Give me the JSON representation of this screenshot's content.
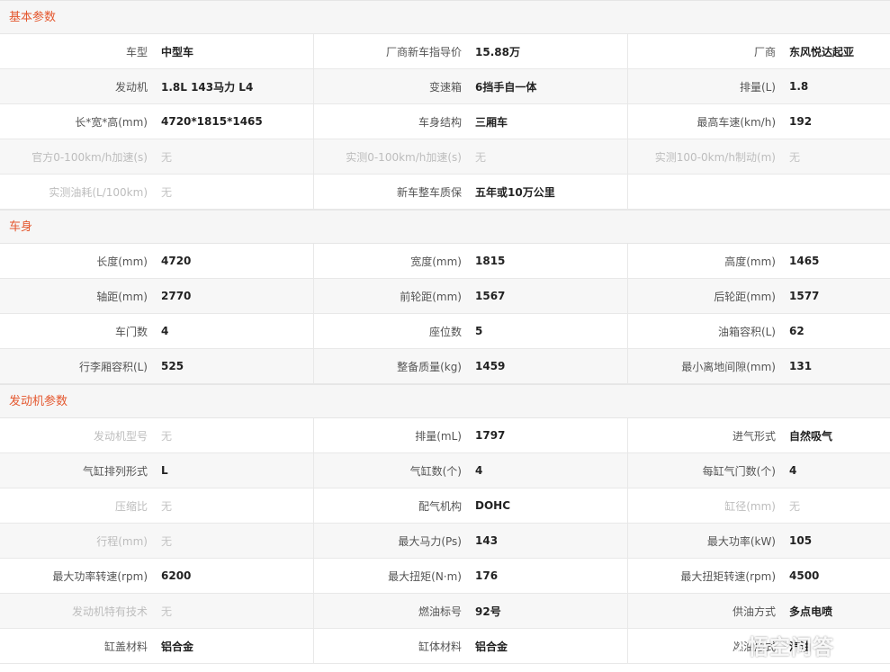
{
  "sections": [
    {
      "title": "基本参数",
      "rows": [
        [
          {
            "label": "车型",
            "value": "中型车"
          },
          {
            "label": "厂商新车指导价",
            "value": "15.88万"
          },
          {
            "label": "厂商",
            "value": "东风悦达起亚"
          }
        ],
        [
          {
            "label": "发动机",
            "value": "1.8L 143马力 L4"
          },
          {
            "label": "变速箱",
            "value": "6挡手自一体"
          },
          {
            "label": "排量(L)",
            "value": "1.8"
          }
        ],
        [
          {
            "label": "长*宽*高(mm)",
            "value": "4720*1815*1465"
          },
          {
            "label": "车身结构",
            "value": "三厢车"
          },
          {
            "label": "最高车速(km/h)",
            "value": "192"
          }
        ],
        [
          {
            "label": "官方0-100km/h加速(s)",
            "value": "无",
            "na": true
          },
          {
            "label": "实测0-100km/h加速(s)",
            "value": "无",
            "na": true
          },
          {
            "label": "实测100-0km/h制动(m)",
            "value": "无",
            "na": true
          }
        ],
        [
          {
            "label": "实测油耗(L/100km)",
            "value": "无",
            "na": true
          },
          {
            "label": "新车整车质保",
            "value": "五年或10万公里"
          },
          {
            "label": "",
            "value": ""
          }
        ]
      ]
    },
    {
      "title": "车身",
      "rows": [
        [
          {
            "label": "长度(mm)",
            "value": "4720"
          },
          {
            "label": "宽度(mm)",
            "value": "1815"
          },
          {
            "label": "高度(mm)",
            "value": "1465"
          }
        ],
        [
          {
            "label": "轴距(mm)",
            "value": "2770"
          },
          {
            "label": "前轮距(mm)",
            "value": "1567"
          },
          {
            "label": "后轮距(mm)",
            "value": "1577"
          }
        ],
        [
          {
            "label": "车门数",
            "value": "4"
          },
          {
            "label": "座位数",
            "value": "5"
          },
          {
            "label": "油箱容积(L)",
            "value": "62"
          }
        ],
        [
          {
            "label": "行李厢容积(L)",
            "value": "525"
          },
          {
            "label": "整备质量(kg)",
            "value": "1459"
          },
          {
            "label": "最小离地间隙(mm)",
            "value": "131"
          }
        ]
      ]
    },
    {
      "title": "发动机参数",
      "rows": [
        [
          {
            "label": "发动机型号",
            "value": "无",
            "na": true
          },
          {
            "label": "排量(mL)",
            "value": "1797"
          },
          {
            "label": "进气形式",
            "value": "自然吸气"
          }
        ],
        [
          {
            "label": "气缸排列形式",
            "value": "L"
          },
          {
            "label": "气缸数(个)",
            "value": "4"
          },
          {
            "label": "每缸气门数(个)",
            "value": "4"
          }
        ],
        [
          {
            "label": "压缩比",
            "value": "无",
            "na": true
          },
          {
            "label": "配气机构",
            "value": "DOHC"
          },
          {
            "label": "缸径(mm)",
            "value": "无",
            "na": true
          }
        ],
        [
          {
            "label": "行程(mm)",
            "value": "无",
            "na": true
          },
          {
            "label": "最大马力(Ps)",
            "value": "143"
          },
          {
            "label": "最大功率(kW)",
            "value": "105"
          }
        ],
        [
          {
            "label": "最大功率转速(rpm)",
            "value": "6200"
          },
          {
            "label": "最大扭矩(N·m)",
            "value": "176"
          },
          {
            "label": "最大扭矩转速(rpm)",
            "value": "4500"
          }
        ],
        [
          {
            "label": "发动机特有技术",
            "value": "无",
            "na": true
          },
          {
            "label": "燃油标号",
            "value": "92号"
          },
          {
            "label": "供油方式",
            "value": "多点电喷"
          }
        ],
        [
          {
            "label": "缸盖材料",
            "value": "铝合金"
          },
          {
            "label": "缸体材料",
            "value": "铝合金"
          },
          {
            "label": "燃油形式",
            "value": "汽油"
          }
        ]
      ]
    }
  ],
  "watermark": {
    "text": "悟空问答",
    "icon": "wukong-logo-icon"
  }
}
